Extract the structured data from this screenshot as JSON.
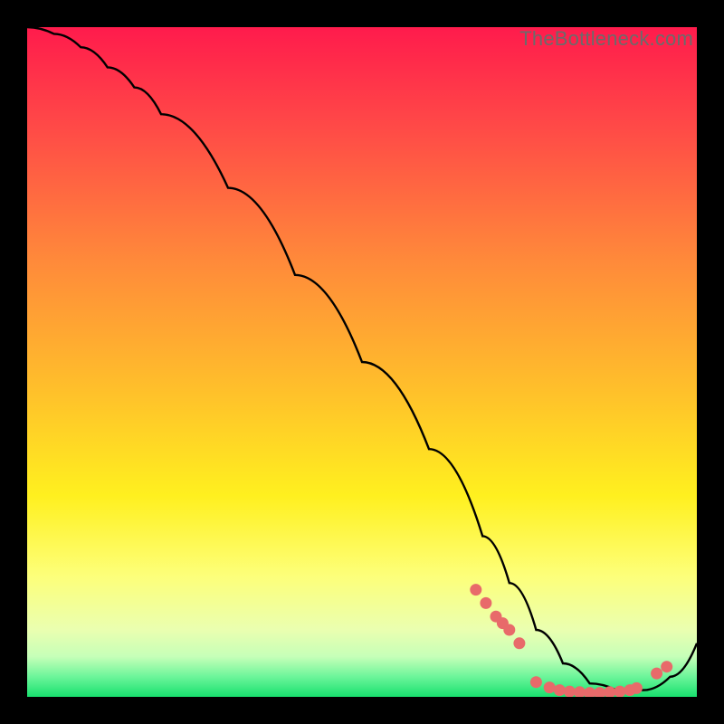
{
  "attribution": {
    "text": "TheBottleneck.com"
  },
  "chart_data": {
    "type": "line",
    "title": "",
    "xlabel": "",
    "ylabel": "",
    "xlim": [
      0,
      100
    ],
    "ylim": [
      0,
      100
    ],
    "grid": false,
    "series": [
      {
        "name": "curve",
        "style": "line",
        "color": "#000000",
        "x": [
          0,
          4,
          8,
          12,
          16,
          20,
          30,
          40,
          50,
          60,
          68,
          72,
          76,
          80,
          84,
          88,
          92,
          96,
          100
        ],
        "y": [
          100,
          99,
          97,
          94,
          91,
          87,
          76,
          63,
          50,
          37,
          24,
          17,
          10,
          5,
          2,
          1,
          1,
          3,
          8
        ]
      },
      {
        "name": "markers-left-cluster",
        "style": "scatter",
        "color": "#e86a6a",
        "x": [
          67,
          68.5,
          70,
          71,
          72,
          73.5
        ],
        "y": [
          16,
          14,
          12,
          11,
          10,
          8
        ]
      },
      {
        "name": "markers-bottom-band",
        "style": "scatter",
        "color": "#e86a6a",
        "x": [
          76,
          78,
          79.5,
          81,
          82.5,
          84,
          85.5,
          87,
          88.5,
          90,
          91
        ],
        "y": [
          2.2,
          1.4,
          1.0,
          0.8,
          0.7,
          0.6,
          0.6,
          0.7,
          0.8,
          1.0,
          1.3
        ]
      },
      {
        "name": "markers-right-pair",
        "style": "scatter",
        "color": "#e86a6a",
        "x": [
          94,
          95.5
        ],
        "y": [
          3.5,
          4.5
        ]
      }
    ]
  },
  "colors": {
    "marker": "#e86a6a",
    "curve": "#000000",
    "watermark": "#6b6b6b"
  }
}
